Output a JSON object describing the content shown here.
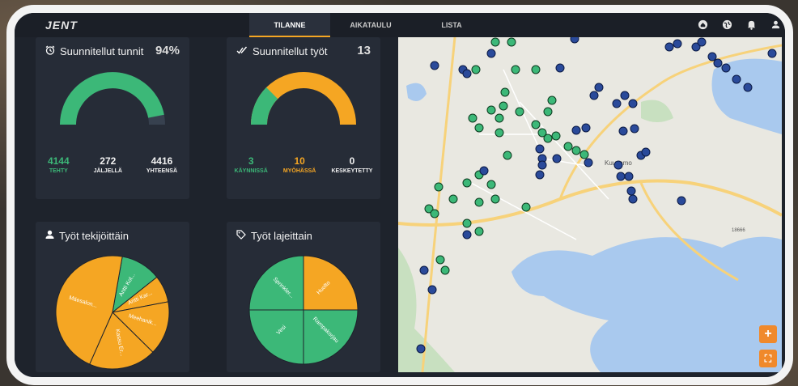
{
  "app": {
    "logo": "JENT"
  },
  "tabs": [
    {
      "label": "TILANNE",
      "active": true
    },
    {
      "label": "AIKATAULU",
      "active": false
    },
    {
      "label": "LISTA",
      "active": false
    }
  ],
  "top_icons": [
    "home-icon",
    "globe-icon",
    "bell-icon",
    "user-icon"
  ],
  "cards": {
    "hours": {
      "title": "Suunnitellut tunnit",
      "value": "94%",
      "icon": "alarm-clock-icon",
      "gauge_fraction": 0.94,
      "gauge_color": "#3cb878",
      "stats": [
        {
          "num": "4144",
          "label": "TEHTY",
          "color": "#3cb878"
        },
        {
          "num": "272",
          "label": "JÄLJELLÄ",
          "color": "#f2f2f2"
        },
        {
          "num": "4416",
          "label": "YHTEENSÄ",
          "color": "#f2f2f2"
        }
      ]
    },
    "jobs": {
      "title": "Suunnitellut työt",
      "value": "13",
      "icon": "double-check-icon",
      "stats": [
        {
          "num": "3",
          "label": "KÄYNNISSÄ",
          "color": "#3cb878"
        },
        {
          "num": "10",
          "label": "MYÖHÄSSÄ",
          "color": "#f5a623"
        },
        {
          "num": "0",
          "label": "KESKEYTETTY",
          "color": "#f2f2f2"
        }
      ]
    },
    "by_worker": {
      "title": "Työt tekijöittäin",
      "icon": "user-icon",
      "slices": [
        "Antti Kol...",
        "Antti Kar...",
        "Meehanik...",
        "Kassu Er...",
        "Mäesalon..."
      ]
    },
    "by_type": {
      "title": "Työt lajeittain",
      "icon": "tag-icon",
      "slices": [
        "Huolto",
        "Rampakorjau",
        "Vesi",
        "Sprinkler..."
      ]
    }
  },
  "map": {
    "city_label": "Kuusamo",
    "road_label": "18666",
    "fab_add": "+",
    "fab_map": "⛶"
  },
  "colors": {
    "green": "#3cb878",
    "orange": "#f5a623",
    "blue": "#2a4a9a",
    "card": "#262c37"
  },
  "chart_data": [
    {
      "type": "pie",
      "title": "Työt tekijöittäin",
      "labels": [
        "Antti Kol...",
        "Antti Kar...",
        "Meehanik...",
        "Kassu Er...",
        "Mäesalon..."
      ],
      "values": [
        1.5,
        1,
        2,
        2.5,
        6
      ],
      "colors": [
        "#3cb878",
        "#f5a623",
        "#f5a623",
        "#f5a623",
        "#f5a623"
      ]
    },
    {
      "type": "pie",
      "title": "Työt lajeittain",
      "labels": [
        "Huolto",
        "Rampakorjau",
        "Vesi",
        "Sprinkler..."
      ],
      "values": [
        1,
        1,
        1,
        1
      ],
      "colors": [
        "#f5a623",
        "#3cb878",
        "#3cb878",
        "#3cb878"
      ]
    }
  ]
}
